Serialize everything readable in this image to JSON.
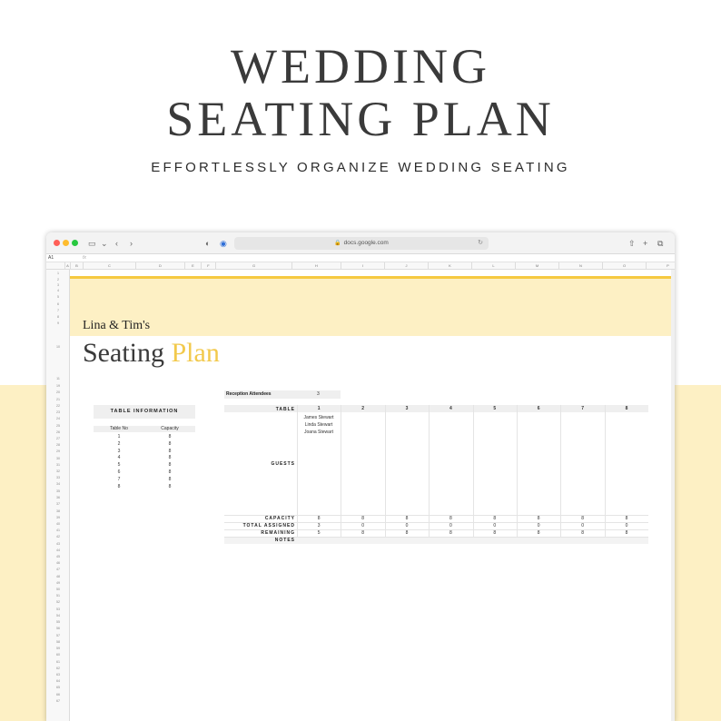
{
  "hero": {
    "title_line1": "WEDDING",
    "title_line2": "SEATING PLAN",
    "subtitle": "EFFORTLESSLY ORGANIZE WEDDING SEATING"
  },
  "browser": {
    "url": "docs.google.com"
  },
  "sheet": {
    "cell_ref": "A1",
    "fx": "fx",
    "columns": [
      "A",
      "B",
      "C",
      "D",
      "E",
      "F",
      "G",
      "H",
      "I",
      "J",
      "K",
      "L",
      "M",
      "N",
      "O",
      "P"
    ],
    "rows": [
      "1",
      "2",
      "3",
      "4",
      "5",
      "6",
      "7",
      "8",
      "9",
      "10",
      "11",
      "19",
      "20",
      "21",
      "22",
      "23",
      "24",
      "25",
      "26",
      "27",
      "28",
      "29",
      "30",
      "31",
      "32",
      "33",
      "34",
      "35",
      "36",
      "37",
      "38",
      "39",
      "40",
      "41",
      "42",
      "43",
      "44",
      "45",
      "46",
      "47",
      "48",
      "49",
      "50",
      "51",
      "52",
      "53",
      "54",
      "55",
      "56",
      "57",
      "58",
      "59",
      "60",
      "61",
      "62",
      "63",
      "64",
      "65",
      "66",
      "67"
    ],
    "couple_names": "Lina & Tim's",
    "plan_title_main": "Seating",
    "plan_title_accent": "Plan",
    "table_info": {
      "heading": "TABLE INFORMATION",
      "col_table_no": "Table No",
      "col_capacity": "Capacity",
      "rows": [
        {
          "no": "1",
          "capacity": "8"
        },
        {
          "no": "2",
          "capacity": "8"
        },
        {
          "no": "3",
          "capacity": "8"
        },
        {
          "no": "4",
          "capacity": "8"
        },
        {
          "no": "5",
          "capacity": "8"
        },
        {
          "no": "6",
          "capacity": "8"
        },
        {
          "no": "7",
          "capacity": "8"
        },
        {
          "no": "8",
          "capacity": "8"
        }
      ]
    },
    "reception": {
      "label": "Reception Attendees",
      "value": "3"
    },
    "grid": {
      "table_label": "TABLE",
      "tables": [
        "1",
        "2",
        "3",
        "4",
        "5",
        "6",
        "7",
        "8"
      ],
      "guests_label": "GUESTS",
      "guests_table1": [
        "James  Stewart",
        "Linda Stewart",
        "Joana Stewart"
      ],
      "capacity_label": "CAPACITY",
      "capacity": [
        "8",
        "8",
        "8",
        "8",
        "8",
        "8",
        "8",
        "8"
      ],
      "assigned_label": "TOTAL ASSIGNED",
      "assigned": [
        "3",
        "0",
        "0",
        "0",
        "0",
        "0",
        "0",
        "0"
      ],
      "remaining_label": "REMAINING",
      "remaining": [
        "5",
        "8",
        "8",
        "8",
        "8",
        "8",
        "8",
        "8"
      ],
      "notes_label": "NOTES"
    }
  }
}
